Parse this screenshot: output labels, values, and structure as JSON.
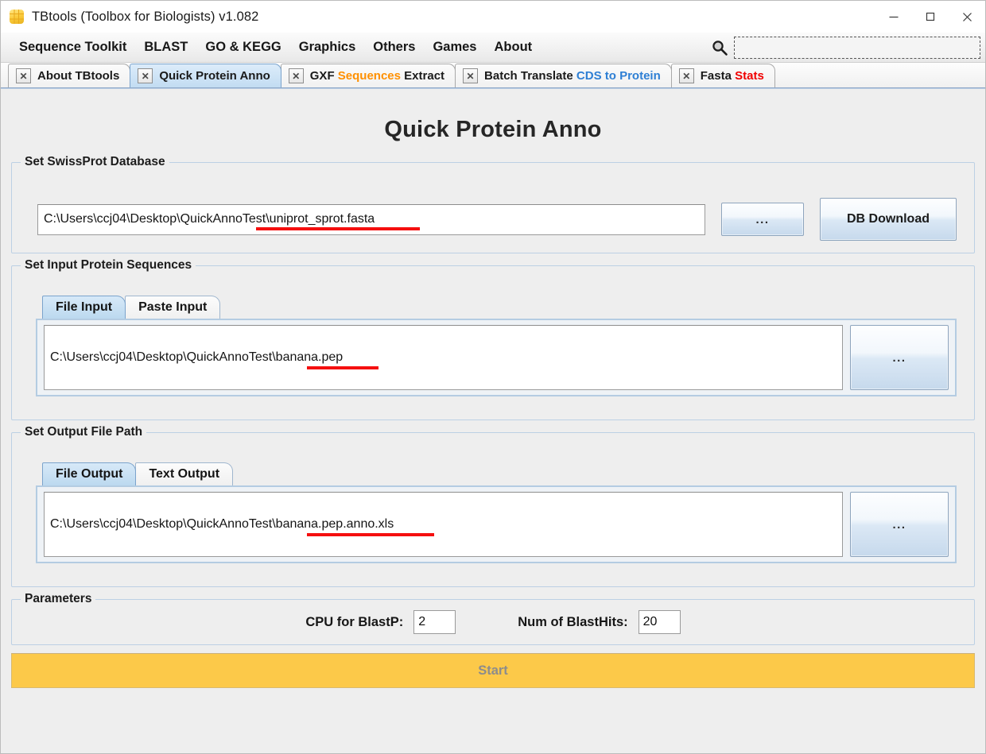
{
  "window": {
    "title": "TBtools (Toolbox for Biologists) v1.082",
    "app_icon": "tbtools-grid-icon",
    "controls": [
      {
        "name": "minimize-button",
        "icon": "minimize-icon"
      },
      {
        "name": "maximize-button",
        "icon": "maximize-icon"
      },
      {
        "name": "close-button",
        "icon": "close-icon"
      }
    ]
  },
  "menubar": {
    "items": [
      {
        "label": "Sequence Toolkit"
      },
      {
        "label": "BLAST"
      },
      {
        "label": "GO & KEGG"
      },
      {
        "label": "Graphics"
      },
      {
        "label": "Others"
      },
      {
        "label": "Games"
      },
      {
        "label": "About"
      }
    ],
    "search": {
      "icon": "search-icon",
      "value": "",
      "placeholder": ""
    }
  },
  "tabs": [
    {
      "close_glyph": "✕",
      "parts": [
        {
          "text": "About TBtools",
          "color": "default"
        }
      ],
      "selected": false
    },
    {
      "close_glyph": "✕",
      "parts": [
        {
          "text": "Quick Protein Anno",
          "color": "default"
        }
      ],
      "selected": true
    },
    {
      "close_glyph": "✕",
      "parts": [
        {
          "text": "GXF ",
          "color": "default"
        },
        {
          "text": "Sequences",
          "color": "orange"
        },
        {
          "text": " Extract",
          "color": "default"
        }
      ],
      "selected": false
    },
    {
      "close_glyph": "✕",
      "parts": [
        {
          "text": "Batch Translate ",
          "color": "default"
        },
        {
          "text": "CDS to Protein",
          "color": "blue"
        }
      ],
      "selected": false
    },
    {
      "close_glyph": "✕",
      "parts": [
        {
          "text": "Fasta ",
          "color": "default"
        },
        {
          "text": "Stats",
          "color": "red"
        }
      ],
      "selected": false
    }
  ],
  "page": {
    "title": "Quick Protein Anno"
  },
  "db_section": {
    "legend": "Set SwissProt Database",
    "path_value": "C:\\Users\\ccj04\\Desktop\\QuickAnnoTest\\uniprot_sprot.fasta",
    "browse_label": "...",
    "download_label": "DB Download"
  },
  "input_section": {
    "legend": "Set Input  Protein Sequences",
    "tabs": [
      {
        "label": "File Input",
        "selected": true
      },
      {
        "label": "Paste Input",
        "selected": false
      }
    ],
    "path_value": "C:\\Users\\ccj04\\Desktop\\QuickAnnoTest\\banana.pep",
    "browse_label": "..."
  },
  "output_section": {
    "legend": "Set Output File Path",
    "tabs": [
      {
        "label": "File Output",
        "selected": true
      },
      {
        "label": "Text Output",
        "selected": false
      }
    ],
    "path_value": "C:\\Users\\ccj04\\Desktop\\QuickAnnoTest\\banana.pep.anno.xls",
    "browse_label": "..."
  },
  "parameters": {
    "legend": "Parameters",
    "cpu": {
      "label": "CPU for BlastP:",
      "value": "2"
    },
    "hits": {
      "label": "Num of BlastHits:",
      "value": "20"
    }
  },
  "start_button": {
    "label": "Start"
  },
  "colors": {
    "accent_tab_selected": "#bcd9ef",
    "start_button_bg": "#fcc949",
    "start_button_text": "#8c8c8c",
    "highlight_orange": "#ff9000",
    "highlight_blue": "#2e7fd4",
    "highlight_red": "#f00000",
    "underline_red": "#f50f0f",
    "content_bg": "#eeeeee",
    "app_icon_gold": "#fbcb3c"
  }
}
